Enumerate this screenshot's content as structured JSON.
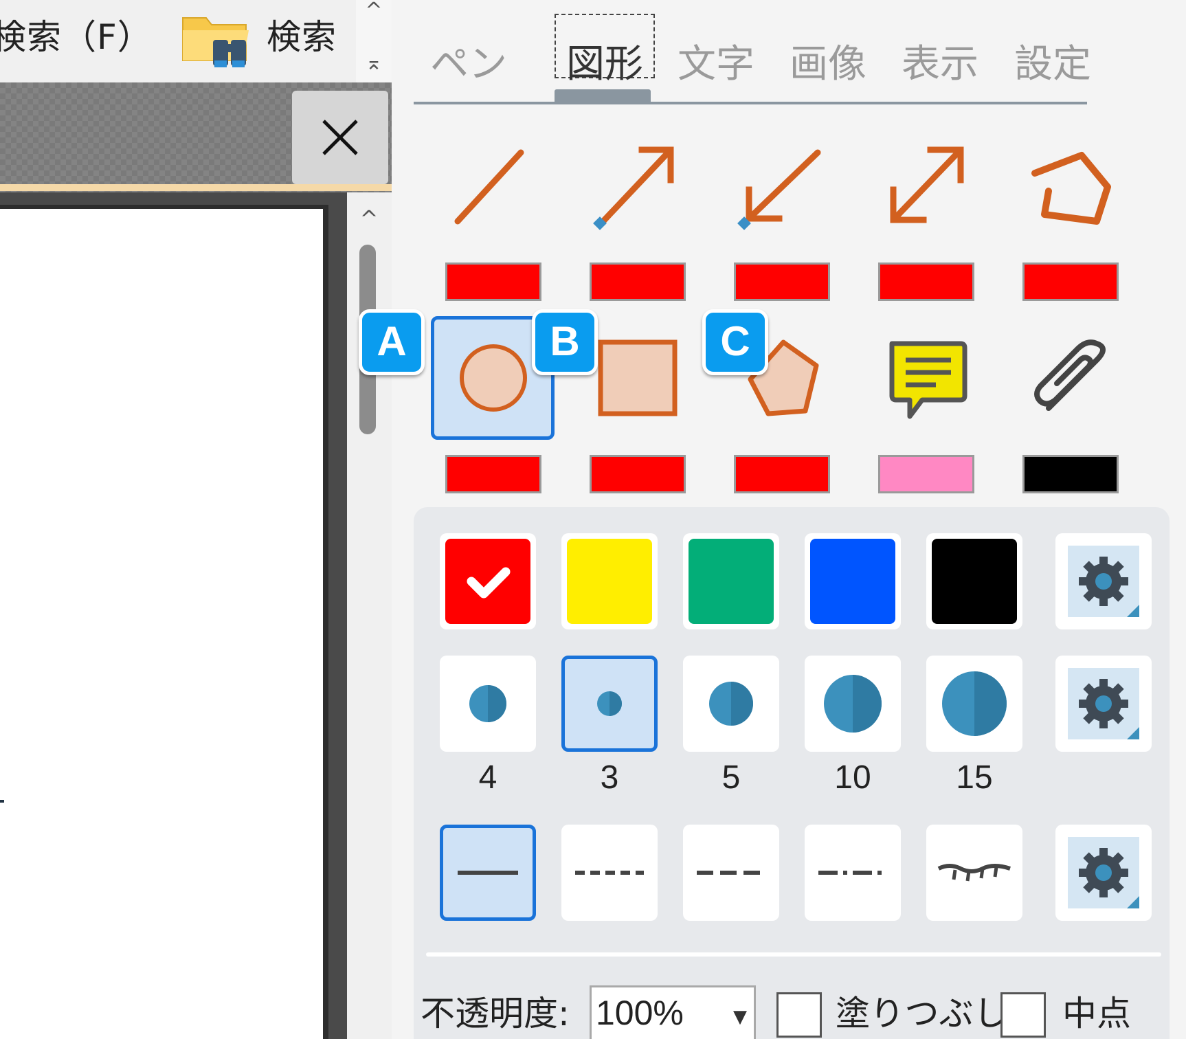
{
  "toolbar": {
    "search_menu_label": "検索（F）",
    "search_button_label": "検索",
    "scroll_up": "^",
    "scroll_top": "⌅"
  },
  "document_tab": {
    "close_label": "×"
  },
  "document": {
    "scroll_up": "^"
  },
  "panel": {
    "tabs": [
      {
        "label": "ペン",
        "selected": false
      },
      {
        "label": "図形",
        "selected": true
      },
      {
        "label": "文字",
        "selected": false
      },
      {
        "label": "画像",
        "selected": false
      },
      {
        "label": "表示",
        "selected": false
      },
      {
        "label": "設定",
        "selected": false
      }
    ],
    "line_tools": [
      {
        "name": "line-tool-icon",
        "color": "#ff0000"
      },
      {
        "name": "arrow-end-tool-icon",
        "color": "#ff0000"
      },
      {
        "name": "arrow-start-tool-icon",
        "color": "#ff0000"
      },
      {
        "name": "double-arrow-tool-icon",
        "color": "#ff0000"
      },
      {
        "name": "polyline-tool-icon",
        "color": "#ff0000"
      }
    ],
    "shape_tools": [
      {
        "name": "ellipse-tool-icon",
        "color": "#ff0000",
        "selected": true
      },
      {
        "name": "rectangle-tool-icon",
        "color": "#ff0000"
      },
      {
        "name": "polygon-tool-icon",
        "color": "#ff0000"
      },
      {
        "name": "sticky-note-tool-icon",
        "color": "#ff88c3"
      },
      {
        "name": "attachment-tool-icon",
        "color": "#000000"
      }
    ],
    "badges": [
      "A",
      "B",
      "C"
    ],
    "colors": [
      {
        "value": "#ff0000",
        "selected": true
      },
      {
        "value": "#ffee00"
      },
      {
        "value": "#03ae78"
      },
      {
        "value": "#0055ff"
      },
      {
        "value": "#000000"
      }
    ],
    "widths": [
      {
        "label": "4",
        "selected": false
      },
      {
        "label": "3",
        "selected": true
      },
      {
        "label": "5",
        "selected": false
      },
      {
        "label": "10",
        "selected": false
      },
      {
        "label": "15",
        "selected": false
      }
    ],
    "line_styles": [
      {
        "name": "solid",
        "selected": true
      },
      {
        "name": "dashed"
      },
      {
        "name": "long-dashed"
      },
      {
        "name": "dash-dot"
      },
      {
        "name": "wavy"
      }
    ],
    "opacity_label": "不透明度:",
    "opacity_value": "100%",
    "fill_label": "塗りつぶし",
    "fill_checked": false,
    "midpoint_label": "中点",
    "midpoint_checked": false
  },
  "accent_color": "#1a73d9",
  "shape_stroke_color": "#d2601f",
  "shape_fill_color": "#f0cdb8"
}
